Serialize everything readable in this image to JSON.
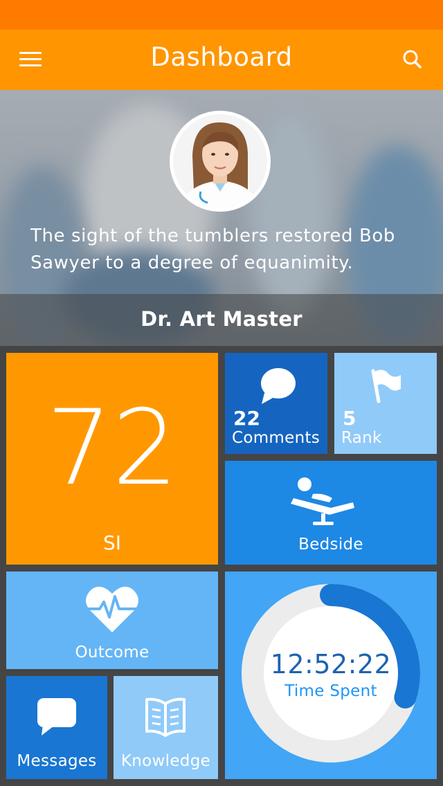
{
  "app_bar": {
    "title": "Dashboard"
  },
  "hero": {
    "quote": "The sight of the tumblers restored Bob Sawyer to a degree of equanimity.",
    "name": "Dr. Art Master"
  },
  "tiles": {
    "si": {
      "value": "72",
      "label": "SI"
    },
    "comments": {
      "count": "22",
      "label": "Comments",
      "icon": "chat-bubble-icon"
    },
    "rank": {
      "count": "5",
      "label": "Rank",
      "icon": "flag-icon"
    },
    "bedside": {
      "label": "Bedside",
      "icon": "patient-bed-icon"
    },
    "outcome": {
      "label": "Outcome",
      "icon": "heartbeat-icon"
    },
    "messages": {
      "label": "Messages",
      "icon": "message-icon"
    },
    "knowledge": {
      "label": "Knowledge",
      "icon": "book-icon"
    },
    "time": {
      "value": "12:52:22",
      "label": "Time Spent",
      "progress": 0.3
    }
  },
  "colors": {
    "status_bar": "#ff7b00",
    "app_bar": "#ff9500",
    "si_tile": "#ff9800",
    "accent_blue": "#1976d2"
  }
}
